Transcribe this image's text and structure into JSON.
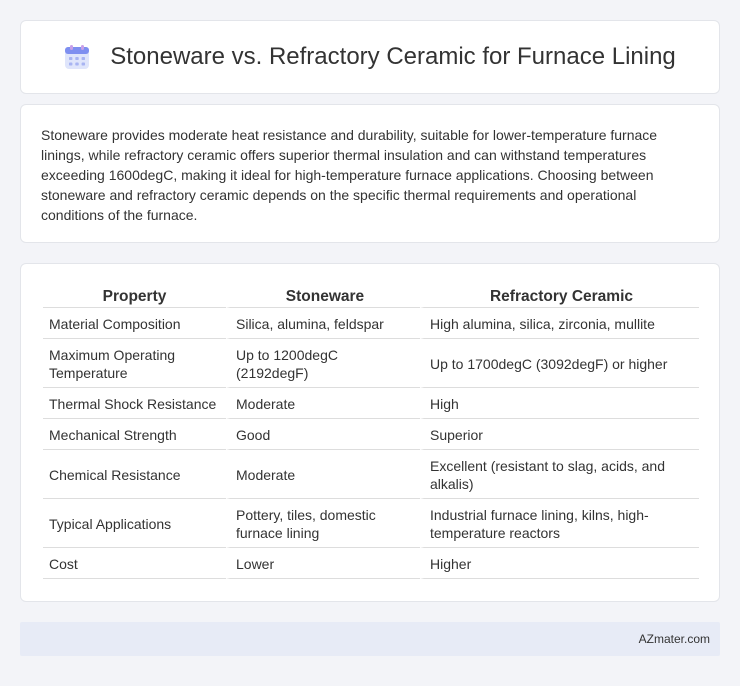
{
  "header": {
    "title": "Stoneware vs. Refractory Ceramic for Furnace Lining",
    "icon": "calendar-icon",
    "icon_color": "#6a7fe0"
  },
  "summary": "Stoneware provides moderate heat resistance and durability, suitable for lower-temperature furnace linings, while refractory ceramic offers superior thermal insulation and can withstand temperatures exceeding 1600degC, making it ideal for high-temperature furnace applications. Choosing between stoneware and refractory ceramic depends on the specific thermal requirements and operational conditions of the furnace.",
  "table": {
    "headers": [
      "Property",
      "Stoneware",
      "Refractory Ceramic"
    ],
    "rows": [
      [
        "Material Composition",
        "Silica, alumina, feldspar",
        "High alumina, silica, zirconia, mullite"
      ],
      [
        "Maximum Operating Temperature",
        "Up to 1200degC (2192degF)",
        "Up to 1700degC (3092degF) or higher"
      ],
      [
        "Thermal Shock Resistance",
        "Moderate",
        "High"
      ],
      [
        "Mechanical Strength",
        "Good",
        "Superior"
      ],
      [
        "Chemical Resistance",
        "Moderate",
        "Excellent (resistant to slag, acids, and alkalis)"
      ],
      [
        "Typical Applications",
        "Pottery, tiles, domestic furnace lining",
        "Industrial furnace lining, kilns, high-temperature reactors"
      ],
      [
        "Cost",
        "Lower",
        "Higher"
      ]
    ]
  },
  "footer": {
    "brand": "AZmater.com"
  }
}
